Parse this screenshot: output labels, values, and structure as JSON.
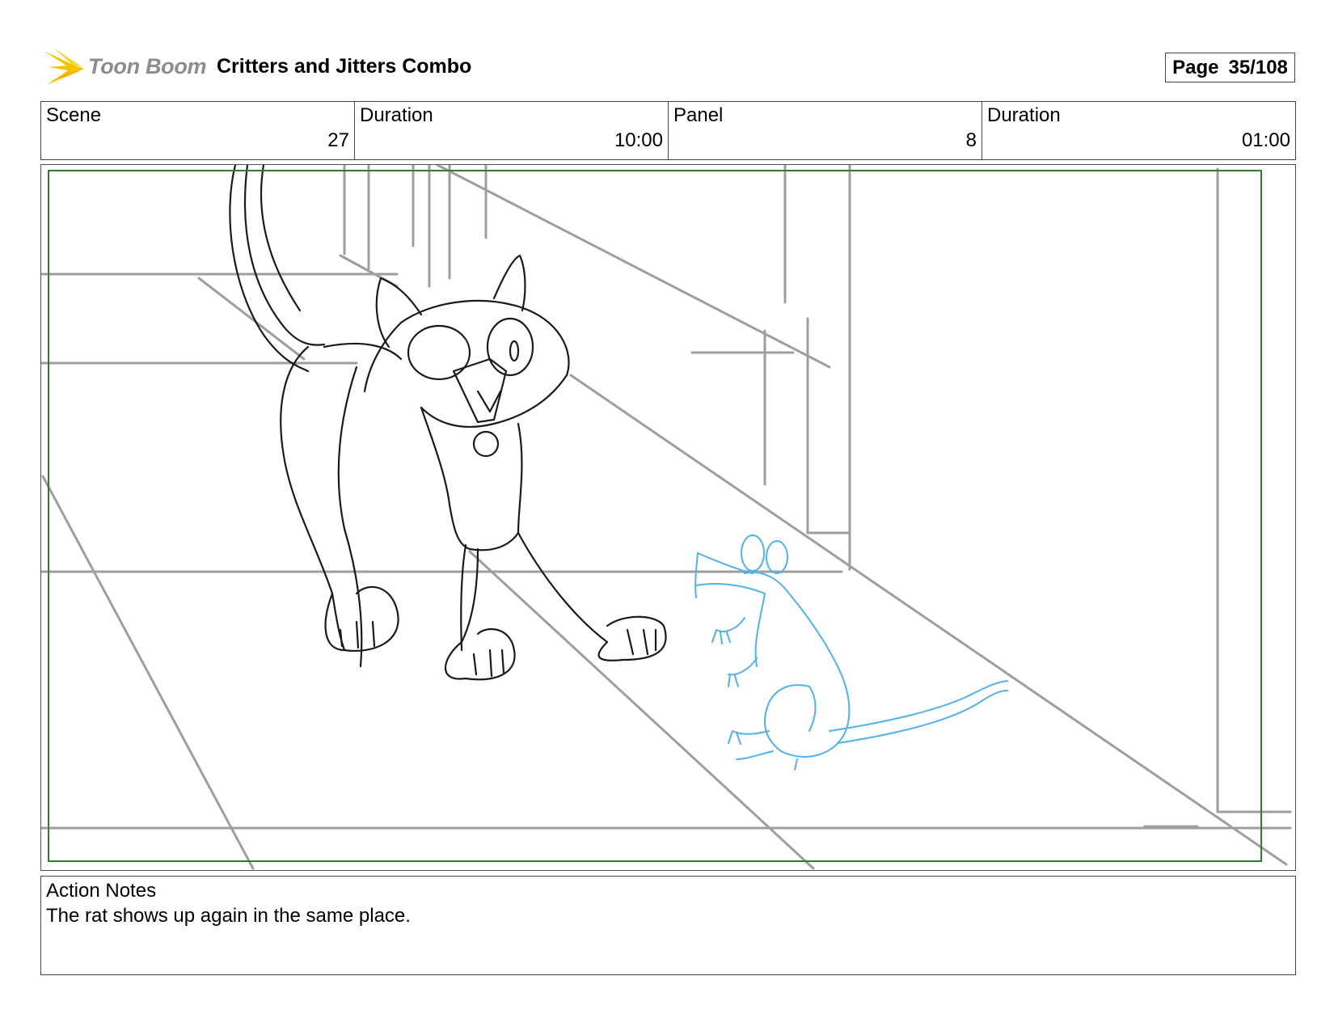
{
  "header": {
    "logo_text": "Toon Boom",
    "project_title": "Critters and Jitters Combo",
    "page_label": "Page",
    "page_value": "35/108"
  },
  "info": {
    "scene_label": "Scene",
    "scene_value": "27",
    "scene_duration_label": "Duration",
    "scene_duration_value": "10:00",
    "panel_label": "Panel",
    "panel_value": "8",
    "panel_duration_label": "Duration",
    "panel_duration_value": "01:00"
  },
  "panel": {
    "safe_frame_color": "#2e7d32",
    "sketch_color": "#1a1a1a",
    "background_line_color": "#9e9e9e",
    "rat_color": "#4fb3e8"
  },
  "notes": {
    "label": "Action Notes",
    "text": "The rat shows up again in the same place."
  }
}
